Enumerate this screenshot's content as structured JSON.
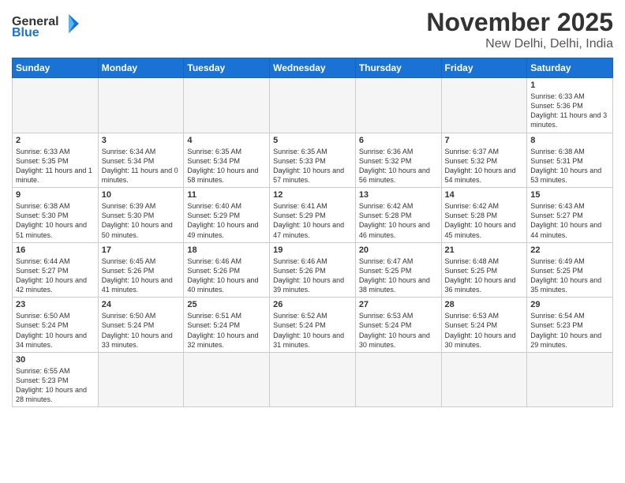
{
  "logo": {
    "text_general": "General",
    "text_blue": "Blue"
  },
  "header": {
    "month": "November 2025",
    "location": "New Delhi, Delhi, India"
  },
  "weekdays": [
    "Sunday",
    "Monday",
    "Tuesday",
    "Wednesday",
    "Thursday",
    "Friday",
    "Saturday"
  ],
  "weeks": [
    [
      {
        "day": "",
        "content": ""
      },
      {
        "day": "",
        "content": ""
      },
      {
        "day": "",
        "content": ""
      },
      {
        "day": "",
        "content": ""
      },
      {
        "day": "",
        "content": ""
      },
      {
        "day": "",
        "content": ""
      },
      {
        "day": "1",
        "content": "Sunrise: 6:33 AM\nSunset: 5:36 PM\nDaylight: 11 hours and 3 minutes."
      }
    ],
    [
      {
        "day": "2",
        "content": "Sunrise: 6:33 AM\nSunset: 5:35 PM\nDaylight: 11 hours and 1 minute."
      },
      {
        "day": "3",
        "content": "Sunrise: 6:34 AM\nSunset: 5:34 PM\nDaylight: 11 hours and 0 minutes."
      },
      {
        "day": "4",
        "content": "Sunrise: 6:35 AM\nSunset: 5:34 PM\nDaylight: 10 hours and 58 minutes."
      },
      {
        "day": "5",
        "content": "Sunrise: 6:35 AM\nSunset: 5:33 PM\nDaylight: 10 hours and 57 minutes."
      },
      {
        "day": "6",
        "content": "Sunrise: 6:36 AM\nSunset: 5:32 PM\nDaylight: 10 hours and 56 minutes."
      },
      {
        "day": "7",
        "content": "Sunrise: 6:37 AM\nSunset: 5:32 PM\nDaylight: 10 hours and 54 minutes."
      },
      {
        "day": "8",
        "content": "Sunrise: 6:38 AM\nSunset: 5:31 PM\nDaylight: 10 hours and 53 minutes."
      }
    ],
    [
      {
        "day": "9",
        "content": "Sunrise: 6:38 AM\nSunset: 5:30 PM\nDaylight: 10 hours and 51 minutes."
      },
      {
        "day": "10",
        "content": "Sunrise: 6:39 AM\nSunset: 5:30 PM\nDaylight: 10 hours and 50 minutes."
      },
      {
        "day": "11",
        "content": "Sunrise: 6:40 AM\nSunset: 5:29 PM\nDaylight: 10 hours and 49 minutes."
      },
      {
        "day": "12",
        "content": "Sunrise: 6:41 AM\nSunset: 5:29 PM\nDaylight: 10 hours and 47 minutes."
      },
      {
        "day": "13",
        "content": "Sunrise: 6:42 AM\nSunset: 5:28 PM\nDaylight: 10 hours and 46 minutes."
      },
      {
        "day": "14",
        "content": "Sunrise: 6:42 AM\nSunset: 5:28 PM\nDaylight: 10 hours and 45 minutes."
      },
      {
        "day": "15",
        "content": "Sunrise: 6:43 AM\nSunset: 5:27 PM\nDaylight: 10 hours and 44 minutes."
      }
    ],
    [
      {
        "day": "16",
        "content": "Sunrise: 6:44 AM\nSunset: 5:27 PM\nDaylight: 10 hours and 42 minutes."
      },
      {
        "day": "17",
        "content": "Sunrise: 6:45 AM\nSunset: 5:26 PM\nDaylight: 10 hours and 41 minutes."
      },
      {
        "day": "18",
        "content": "Sunrise: 6:46 AM\nSunset: 5:26 PM\nDaylight: 10 hours and 40 minutes."
      },
      {
        "day": "19",
        "content": "Sunrise: 6:46 AM\nSunset: 5:26 PM\nDaylight: 10 hours and 39 minutes."
      },
      {
        "day": "20",
        "content": "Sunrise: 6:47 AM\nSunset: 5:25 PM\nDaylight: 10 hours and 38 minutes."
      },
      {
        "day": "21",
        "content": "Sunrise: 6:48 AM\nSunset: 5:25 PM\nDaylight: 10 hours and 36 minutes."
      },
      {
        "day": "22",
        "content": "Sunrise: 6:49 AM\nSunset: 5:25 PM\nDaylight: 10 hours and 35 minutes."
      }
    ],
    [
      {
        "day": "23",
        "content": "Sunrise: 6:50 AM\nSunset: 5:24 PM\nDaylight: 10 hours and 34 minutes."
      },
      {
        "day": "24",
        "content": "Sunrise: 6:50 AM\nSunset: 5:24 PM\nDaylight: 10 hours and 33 minutes."
      },
      {
        "day": "25",
        "content": "Sunrise: 6:51 AM\nSunset: 5:24 PM\nDaylight: 10 hours and 32 minutes."
      },
      {
        "day": "26",
        "content": "Sunrise: 6:52 AM\nSunset: 5:24 PM\nDaylight: 10 hours and 31 minutes."
      },
      {
        "day": "27",
        "content": "Sunrise: 6:53 AM\nSunset: 5:24 PM\nDaylight: 10 hours and 30 minutes."
      },
      {
        "day": "28",
        "content": "Sunrise: 6:53 AM\nSunset: 5:24 PM\nDaylight: 10 hours and 30 minutes."
      },
      {
        "day": "29",
        "content": "Sunrise: 6:54 AM\nSunset: 5:23 PM\nDaylight: 10 hours and 29 minutes."
      }
    ],
    [
      {
        "day": "30",
        "content": "Sunrise: 6:55 AM\nSunset: 5:23 PM\nDaylight: 10 hours and 28 minutes."
      },
      {
        "day": "",
        "content": ""
      },
      {
        "day": "",
        "content": ""
      },
      {
        "day": "",
        "content": ""
      },
      {
        "day": "",
        "content": ""
      },
      {
        "day": "",
        "content": ""
      },
      {
        "day": "",
        "content": ""
      }
    ]
  ]
}
